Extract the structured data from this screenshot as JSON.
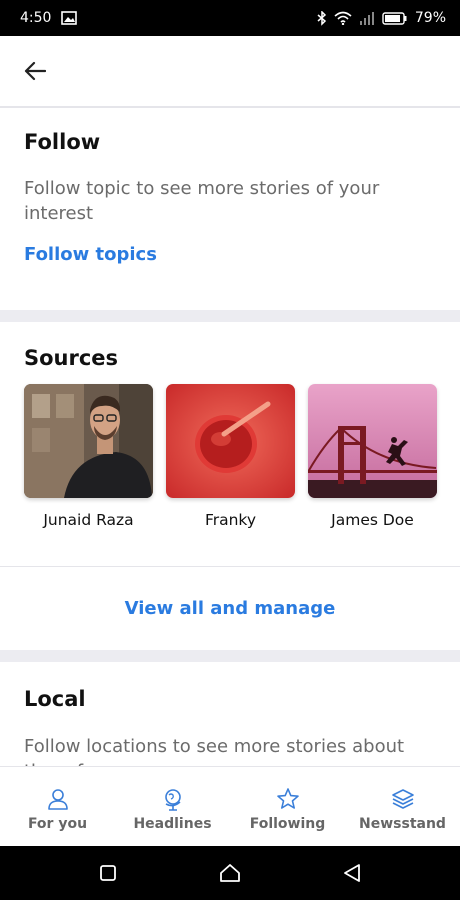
{
  "status_bar": {
    "time": "4:50",
    "battery": "79%",
    "icons": [
      "image-icon",
      "bluetooth-icon",
      "wifi-icon",
      "signal-icon",
      "battery-icon"
    ]
  },
  "app_bar": {
    "back_icon": "arrow-left-icon"
  },
  "follow": {
    "title": "Follow",
    "description": "Follow topic to see more stories of your interest",
    "link": "Follow topics"
  },
  "sources": {
    "title": "Sources",
    "items": [
      {
        "name": "Junaid Raza"
      },
      {
        "name": "Franky"
      },
      {
        "name": "James Doe"
      }
    ],
    "view_all": "View all and manage"
  },
  "local": {
    "title": "Local",
    "description": "Follow locations to see more stories about them from"
  },
  "bottom_nav": {
    "items": [
      {
        "label": "For you",
        "icon": "person-icon"
      },
      {
        "label": "Headlines",
        "icon": "globe-icon"
      },
      {
        "label": "Following",
        "icon": "star-icon"
      },
      {
        "label": "Newsstand",
        "icon": "layers-icon"
      }
    ]
  },
  "colors": {
    "accent": "#2a7be0",
    "nav_icon": "#3b7fd9",
    "divider": "#ececf1"
  }
}
